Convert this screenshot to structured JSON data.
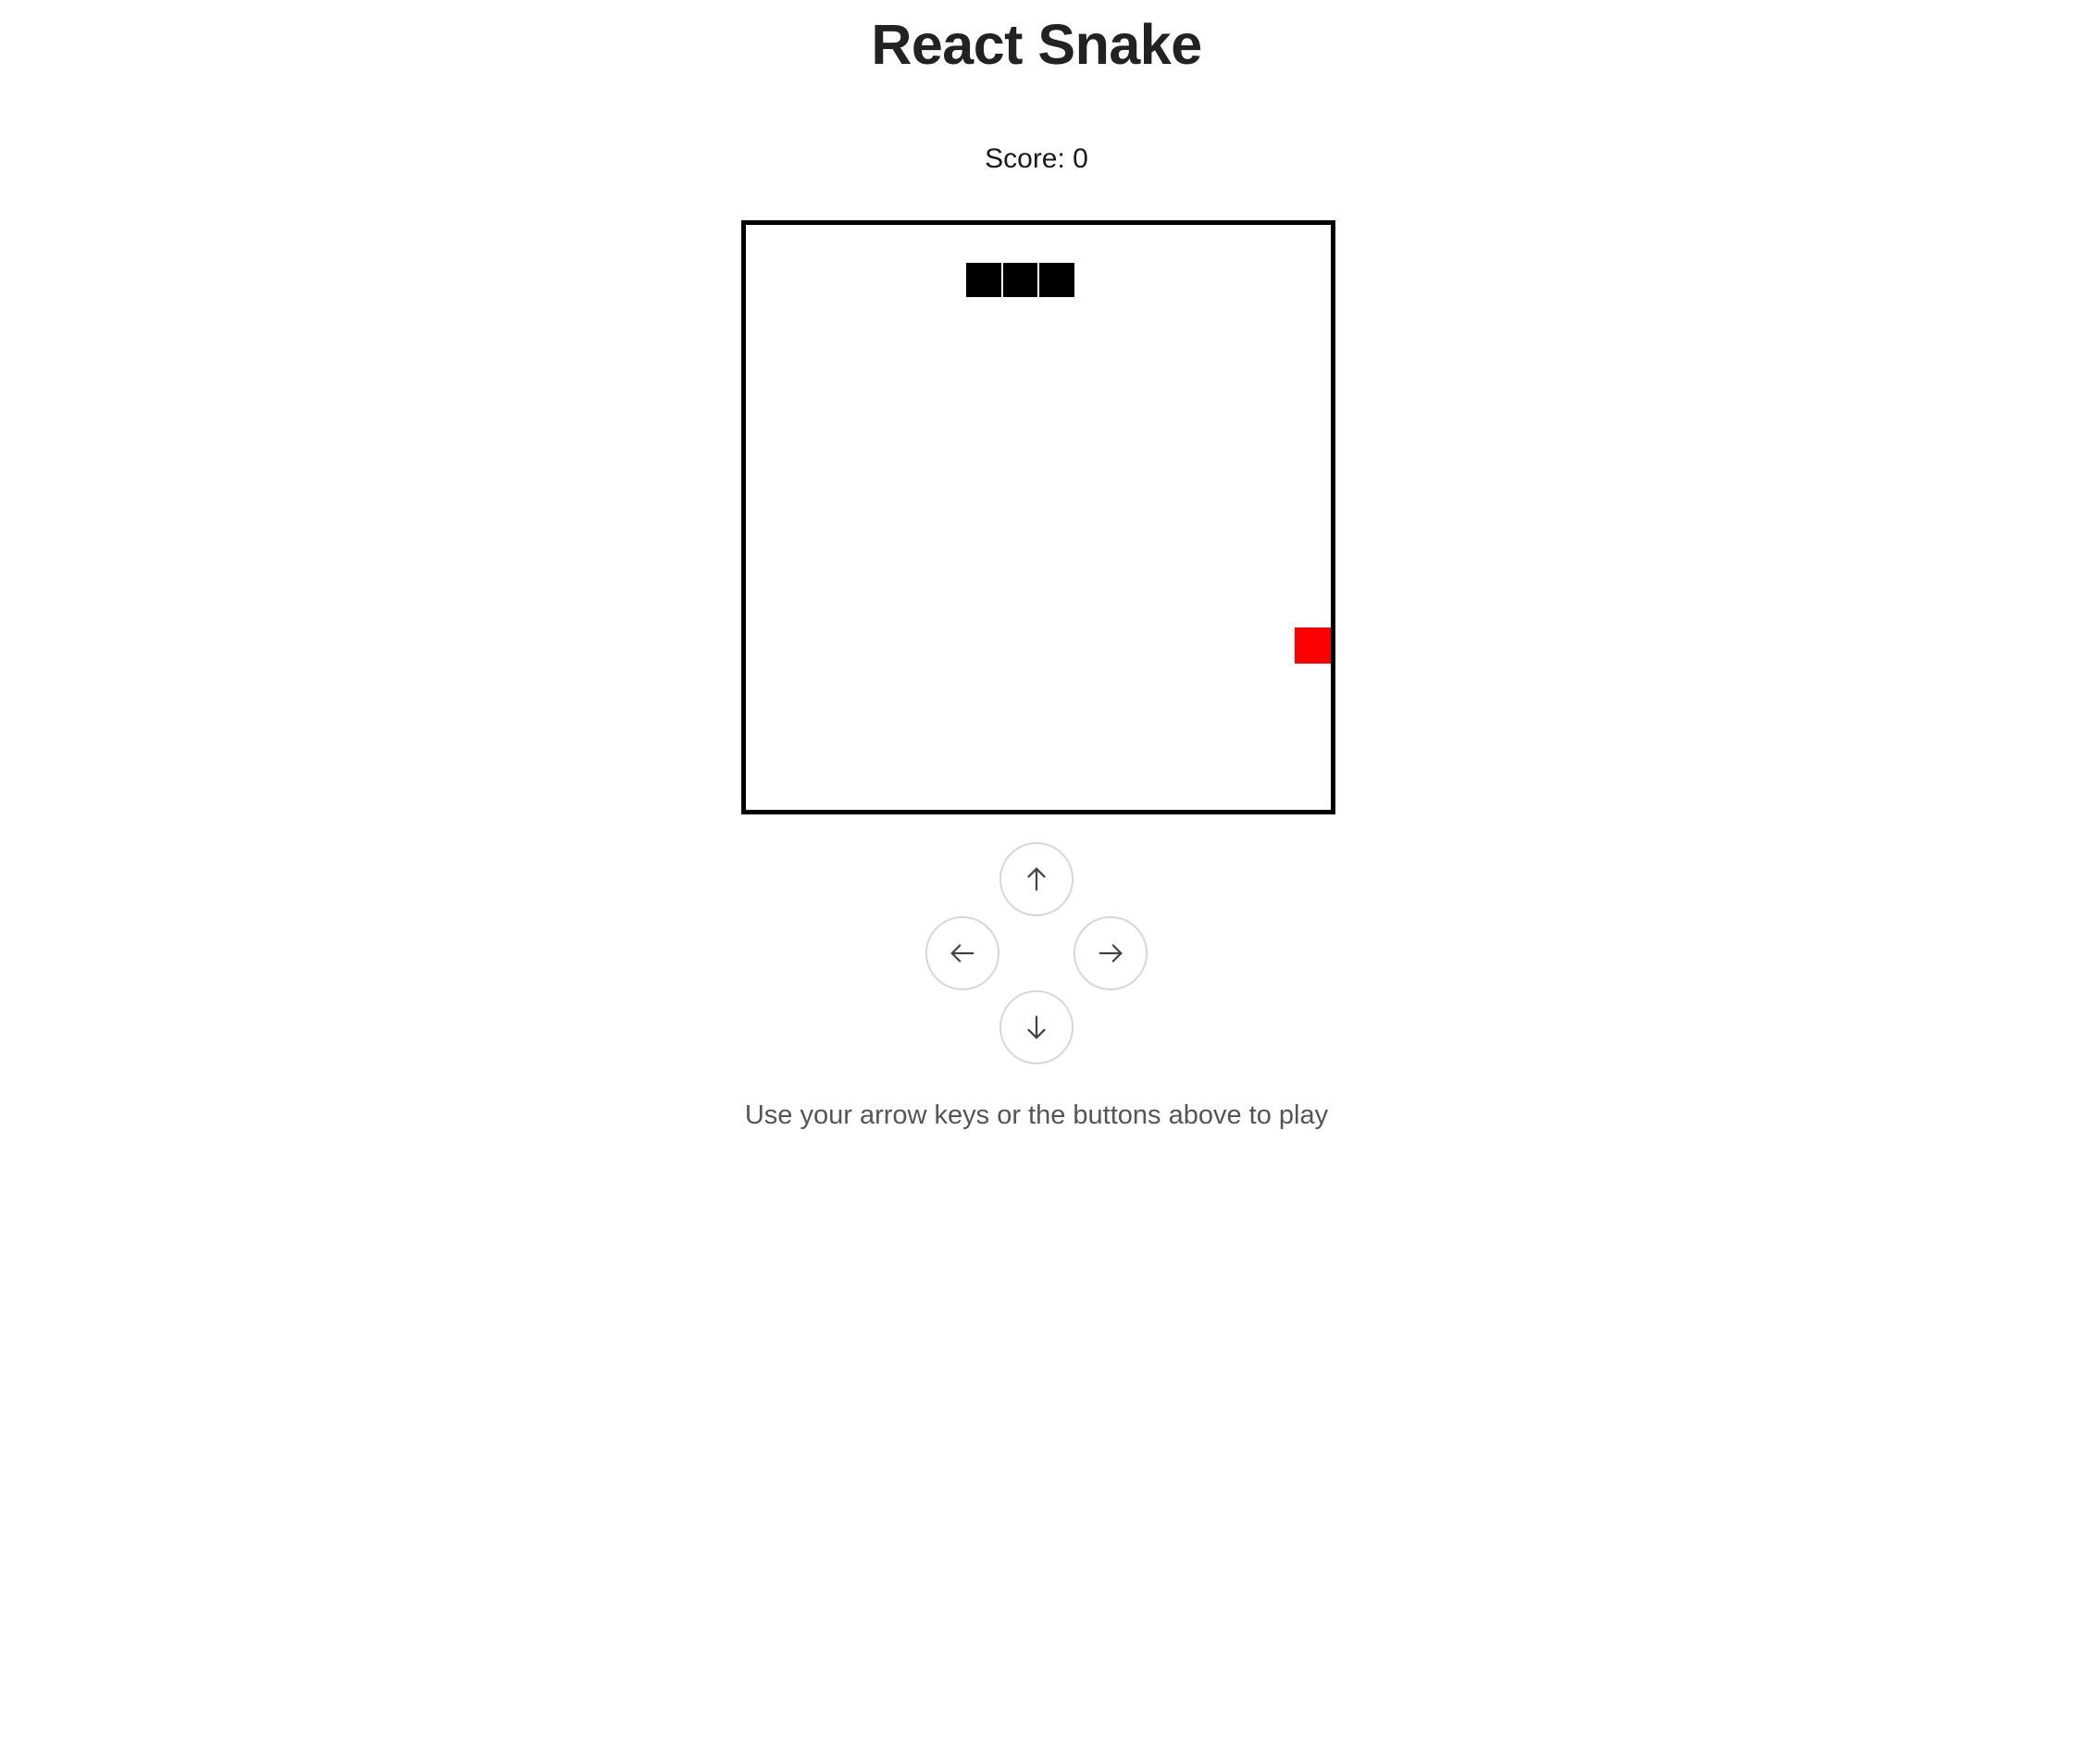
{
  "game": {
    "title": "React Snake",
    "score_label": "Score: 0",
    "score": 0,
    "instructions": "Use your arrow keys or the buttons above to play"
  },
  "board": {
    "grid_cols": 16,
    "grid_rows": 16,
    "snake_cells": [
      [
        6,
        1
      ],
      [
        7,
        1
      ],
      [
        8,
        1
      ]
    ],
    "food_cell": [
      15,
      11
    ],
    "snake_color": "#000000",
    "food_color": "#ff0000",
    "border_color": "#000000"
  },
  "controls": {
    "up": {
      "icon": "arrow-up-icon"
    },
    "left": {
      "icon": "arrow-left-icon"
    },
    "right": {
      "icon": "arrow-right-icon"
    },
    "down": {
      "icon": "arrow-down-icon"
    }
  }
}
